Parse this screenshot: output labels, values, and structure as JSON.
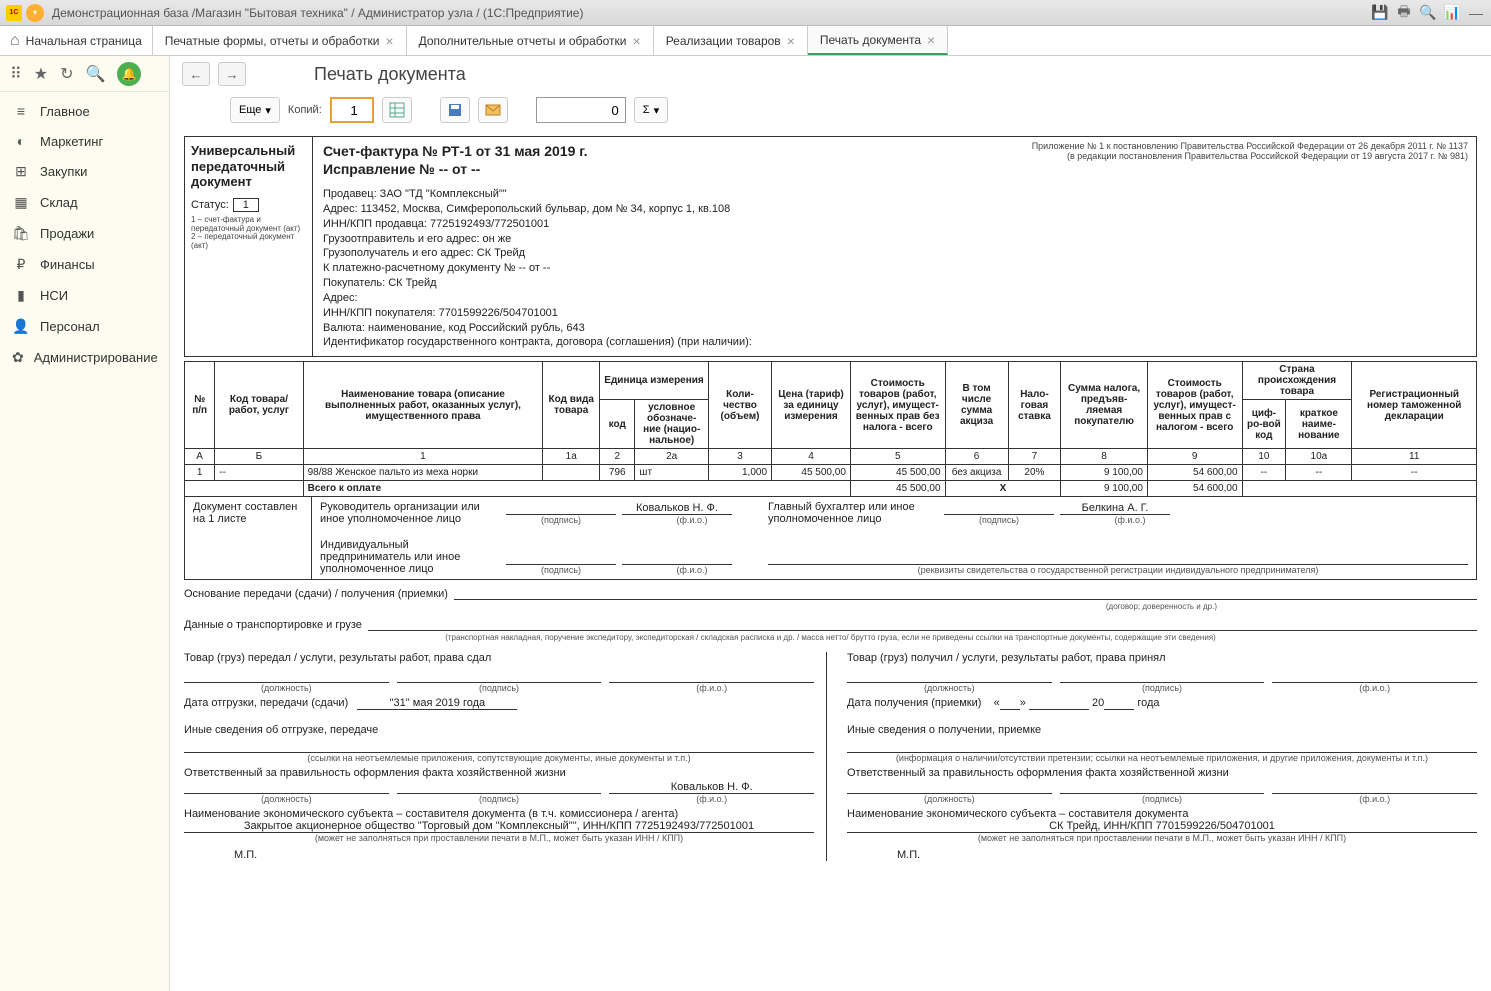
{
  "titlebar": {
    "title": "Демонстрационная база /Магазин \"Бытовая техника\" / Администратор узла / (1С:Предприятие)"
  },
  "tabs": {
    "home": "Начальная страница",
    "t1": "Печатные формы, отчеты и обработки",
    "t2": "Дополнительные отчеты и обработки",
    "t3": "Реализации товаров",
    "t4": "Печать документа"
  },
  "sidebar": {
    "items": [
      {
        "icon": "≡",
        "label": "Главное"
      },
      {
        "icon": "◐",
        "label": "Маркетинг"
      },
      {
        "icon": "⊞",
        "label": "Закупки"
      },
      {
        "icon": "▦",
        "label": "Склад"
      },
      {
        "icon": "🛍",
        "label": "Продажи"
      },
      {
        "icon": "₽",
        "label": "Финансы"
      },
      {
        "icon": "▮",
        "label": "НСИ"
      },
      {
        "icon": "👤",
        "label": "Персонал"
      },
      {
        "icon": "✿",
        "label": "Администрирование"
      }
    ]
  },
  "page": {
    "title": "Печать документа"
  },
  "toolbar": {
    "more": "Еще",
    "copies_label": "Копий:",
    "copies_value": "1",
    "num_value": "0",
    "sigma": "Σ"
  },
  "doc": {
    "upd_title": "Универсальный передаточный документ",
    "status_label": "Статус:",
    "status_value": "1",
    "status_note1": "1 – счет-фактура и передаточный документ (акт)",
    "status_note2": "2 – передаточный документ (акт)",
    "invoice_header": "Счет-фактура № РТ-1 от 31 мая 2019 г.",
    "correction_header": "Исправление № -- от --",
    "right_note1": "Приложение № 1 к постановлению Правительства Российской Федерации от 26 декабря 2011 г. № 1137",
    "right_note2": "(в редакции постановления Правительства Российской Федерации от 19 августа 2017 г. № 981)",
    "seller": "Продавец: ЗАО \"ТД \"Комплексный\"\"",
    "seller_addr": "Адрес: 113452, Москва, Симферопольский бульвар, дом № 34, корпус 1, кв.108",
    "seller_inn": "ИНН/КПП продавца: 7725192493/772501001",
    "shipper": "Грузоотправитель и его адрес: он же",
    "consignee": "Грузополучатель и его адрес: СК Трейд",
    "payment_doc": "К платежно-расчетному документу № -- от --",
    "buyer": "Покупатель: СК Трейд",
    "buyer_addr": "Адрес:",
    "buyer_inn": "ИНН/КПП покупателя: 7701599226/504701001",
    "currency": "Валюта: наименование, код Российский рубль, 643",
    "contract_id": "Идентификатор государственного контракта, договора (соглашения) (при наличии):"
  },
  "thead": {
    "c1": "№ п/п",
    "c2": "Код товара/ работ, услуг",
    "c3": "Наименование товара (описание выполненных работ, оказанных услуг), имущественного права",
    "c4": "Код вида товара",
    "c5": "Единица измерения",
    "c5a": "код",
    "c5b": "условное обозначе-ние (нацио-нальное)",
    "c6": "Коли-чество (объем)",
    "c7": "Цена (тариф) за единицу измерения",
    "c8": "Стоимость товаров (работ, услуг), имущест-венных прав без налога - всего",
    "c9": "В том числе сумма акциза",
    "c10": "Нало-говая ставка",
    "c11": "Сумма налога, предъяв-ляемая покупателю",
    "c12": "Стоимость товаров (работ, услуг), имущест-венных прав с налогом - всего",
    "c13": "Страна происхождения товара",
    "c13a": "циф-ро-вой код",
    "c13b": "краткое наиме-нование",
    "c14": "Регистрационный номер таможенной декларации"
  },
  "trow_nums": {
    "a": "А",
    "b": "Б",
    "n1": "1",
    "n1a": "1а",
    "n2": "2",
    "n2a": "2а",
    "n3": "3",
    "n4": "4",
    "n5": "5",
    "n6": "6",
    "n7": "7",
    "n8": "8",
    "n9": "9",
    "n10": "10",
    "n10a": "10а",
    "n11": "11"
  },
  "row1": {
    "num": "1",
    "code": "--",
    "name": "98/88 Женское пальто из меха норки",
    "kind": "",
    "uom_code": "796",
    "uom_name": "шт",
    "qty": "1,000",
    "price": "45 500,00",
    "cost": "45 500,00",
    "excise": "без акциза",
    "rate": "20%",
    "tax": "9 100,00",
    "total": "54 600,00",
    "country_code": "--",
    "country_name": "--",
    "gtd": "--"
  },
  "totals": {
    "label": "Всего к оплате",
    "cost": "45 500,00",
    "x": "X",
    "tax": "9 100,00",
    "total": "54 600,00"
  },
  "sign": {
    "doc_pages": "Документ составлен на 1 листе",
    "head": "Руководитель организации или иное уполномоченное лицо",
    "head_name": "Ковальков Н. Ф.",
    "acc": "Главный бухгалтер или иное уполномоченное лицо",
    "acc_name": "Белкина А. Г.",
    "ip": "Индивидуальный предприниматель или иное уполномоченное лицо",
    "sub_sign": "(подпись)",
    "sub_fio": "(ф.и.о.)",
    "sub_ip": "(реквизиты свидетельства о государственной  регистрации индивидуального предпринимателя)"
  },
  "bottom": {
    "basis": "Основание передачи (сдачи) / получения (приемки)",
    "basis_note": "(договор; доверенность и др.)",
    "transport": "Данные о транспортировке и грузе",
    "transport_note": "(транспортная накладная, поручение экспедитору, экспедиторская / складская расписка и др. / масса нетто/ брутто груза, если не приведены ссылки на транспортные документы, содержащие эти сведения)",
    "left_title": "Товар (груз) передал / услуги, результаты работ, права сдал",
    "right_title": "Товар (груз) получил / услуги, результаты работ, права принял",
    "sub_pos": "(должность)",
    "sub_sign": "(подпись)",
    "sub_fio": "(ф.и.о.)",
    "ship_date_lbl": "Дата отгрузки, передачи (сдачи)",
    "ship_date": "\"31\" мая 2019 года",
    "recv_date_lbl": "Дата получения (приемки)",
    "recv_date_q1": "«",
    "recv_date_q2": "»",
    "recv_date_yr": "20",
    "recv_date_g": "года",
    "other_ship": "Иные сведения об отгрузке, передаче",
    "other_ship_note": "(ссылки на неотъемлемые приложения, сопутствующие документы, иные документы и т.п.)",
    "other_recv": "Иные сведения о получении, приемке",
    "other_recv_note": "(информация о наличии/отсутствии претензии; ссылки на неотъемлемые приложения, и другие приложения, документы и т.п.)",
    "resp": "Ответственный за правильность оформления факта хозяйственной жизни",
    "resp_name": "Ковальков Н. Ф.",
    "entity_lbl_l": "Наименование экономического субъекта – составителя документа (в т.ч. комиссионера / агента)",
    "entity_lbl_r": "Наименование экономического субъекта – составителя документа",
    "entity_l": "Закрытое акционерное общество \"Торговый дом \"Комплексный\"\", ИНН/КПП 7725192493/772501001",
    "entity_r": "СК Трейд, ИНН/КПП 7701599226/504701001",
    "entity_note": "(может не заполняться при проставлении печати в М.П., может быть указан ИНН / КПП)",
    "mp": "М.П."
  }
}
